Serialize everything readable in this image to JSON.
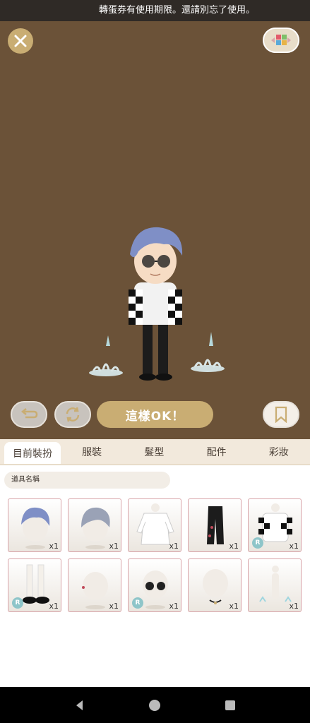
{
  "notice": {
    "text": "轉蛋券有使用期限。還請別忘了使用。"
  },
  "actions": {
    "ok_label": "這樣OK！"
  },
  "tabs": [
    {
      "label": "目前裝扮",
      "active": true
    },
    {
      "label": "服裝",
      "active": false
    },
    {
      "label": "髮型",
      "active": false
    },
    {
      "label": "配件",
      "active": false
    },
    {
      "label": "彩妝",
      "active": false
    }
  ],
  "search": {
    "placeholder": "道具名稱"
  },
  "items": [
    {
      "name": "blue-hair-back",
      "qty": "x1",
      "rare": false
    },
    {
      "name": "blue-hair-front",
      "qty": "x1",
      "rare": false
    },
    {
      "name": "white-shirt",
      "qty": "x1",
      "rare": false
    },
    {
      "name": "black-pants",
      "qty": "x1",
      "rare": false
    },
    {
      "name": "checkered-jacket",
      "qty": "x1",
      "rare": true
    },
    {
      "name": "socks-shoes",
      "qty": "x1",
      "rare": true
    },
    {
      "name": "ear-piercing",
      "qty": "x1",
      "rare": false
    },
    {
      "name": "round-sunglasses",
      "qty": "x1",
      "rare": true
    },
    {
      "name": "choker-necklace",
      "qty": "x1",
      "rare": false
    },
    {
      "name": "sparkle-effect",
      "qty": "x1",
      "rare": false
    }
  ],
  "colors": {
    "stage": "#6b5238",
    "gold": "#c9ad73",
    "tab_bg": "#f2e9dc",
    "item_border": "#d8a3a8"
  },
  "icons": [
    "close-icon",
    "palette-icon",
    "undo-icon",
    "refresh-icon",
    "bookmark-icon",
    "back-icon",
    "home-icon",
    "recents-icon"
  ]
}
